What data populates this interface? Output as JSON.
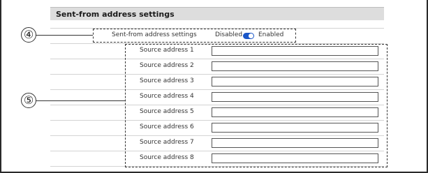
{
  "section": {
    "title": "Sent-from address settings"
  },
  "sent_from": {
    "label": "Sent-from address settings",
    "disabled_label": "Disabled",
    "enabled_label": "Enabled",
    "toggle_state": "Enabled"
  },
  "callouts": {
    "four": "④",
    "five": "⑤"
  },
  "addresses": [
    {
      "label": "Source address 1",
      "value": ""
    },
    {
      "label": "Source address 2",
      "value": ""
    },
    {
      "label": "Source address 3",
      "value": ""
    },
    {
      "label": "Source address 4",
      "value": ""
    },
    {
      "label": "Source address 5",
      "value": ""
    },
    {
      "label": "Source address 6",
      "value": ""
    },
    {
      "label": "Source address 7",
      "value": ""
    },
    {
      "label": "Source address 8",
      "value": ""
    }
  ],
  "colors": {
    "toggle_on": "#1b57c8",
    "header_bg": "#dddddd"
  }
}
